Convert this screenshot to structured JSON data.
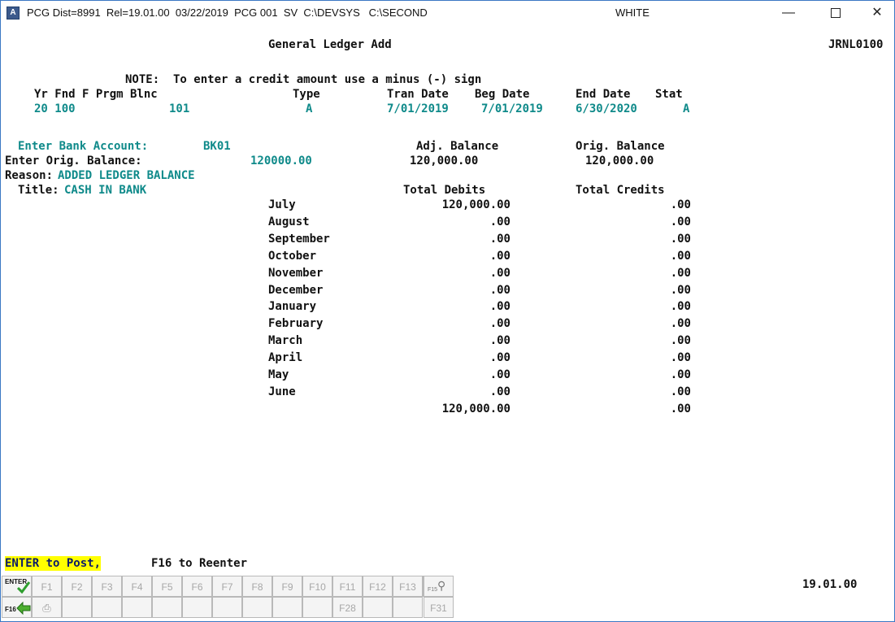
{
  "titlebar": {
    "info": "PCG Dist=8991  Rel=19.01.00  03/22/2019  PCG 001  SV  C:\\DEVSYS   C:\\SECOND",
    "user": "WHITE",
    "app_icon": "A"
  },
  "screen": {
    "title": "General Ledger Add",
    "code": "JRNL0100",
    "note": "NOTE:  To enter a credit amount use a minus (-) sign",
    "key_headers": {
      "yr_fnd_f_prgm_blnc": "Yr Fnd F Prgm Blnc",
      "type": "Type",
      "tran_date": "Tran Date",
      "beg_date": "Beg Date",
      "end_date": "End Date",
      "stat": "Stat"
    },
    "key_values": {
      "yr_fnd": "20 100",
      "blnc": "101",
      "type": "A",
      "tran_date": "7/01/2019",
      "beg_date": "7/01/2019",
      "end_date": "6/30/2020",
      "stat": "A"
    },
    "bank_account_label": "Enter Bank Account:",
    "bank_account_value": "BK01",
    "orig_balance_label": "Enter Orig. Balance:",
    "orig_balance_value": "120000.00",
    "reason_label": "Reason:",
    "reason_value": "ADDED LEDGER BALANCE",
    "title_label": "Title:",
    "title_value": "CASH IN BANK",
    "adj_balance_header": "Adj. Balance",
    "orig_balance_header": "Orig. Balance",
    "adj_balance_value": "120,000.00",
    "orig_balance_display": "120,000.00",
    "total_debits_header": "Total Debits",
    "total_credits_header": "Total Credits",
    "months": [
      {
        "name": "July",
        "debits": "120,000.00",
        "credits": ".00"
      },
      {
        "name": "August",
        "debits": ".00",
        "credits": ".00"
      },
      {
        "name": "September",
        "debits": ".00",
        "credits": ".00"
      },
      {
        "name": "October",
        "debits": ".00",
        "credits": ".00"
      },
      {
        "name": "November",
        "debits": ".00",
        "credits": ".00"
      },
      {
        "name": "December",
        "debits": ".00",
        "credits": ".00"
      },
      {
        "name": "January",
        "debits": ".00",
        "credits": ".00"
      },
      {
        "name": "February",
        "debits": ".00",
        "credits": ".00"
      },
      {
        "name": "March",
        "debits": ".00",
        "credits": ".00"
      },
      {
        "name": "April",
        "debits": ".00",
        "credits": ".00"
      },
      {
        "name": "May",
        "debits": ".00",
        "credits": ".00"
      },
      {
        "name": "June",
        "debits": ".00",
        "credits": ".00"
      }
    ],
    "totals": {
      "debits": "120,000.00",
      "credits": ".00"
    },
    "prompt_enter": "ENTER to Post,",
    "prompt_f16": "F16 to Reenter",
    "version": "19.01.00"
  },
  "fkeys": {
    "enter_label": "ENTER",
    "f16_label": "F16",
    "f15_label": "F15",
    "top": [
      "F1",
      "F2",
      "F3",
      "F4",
      "F5",
      "F6",
      "F7",
      "F8",
      "F9",
      "F10",
      "F11",
      "F12",
      "F13",
      "F14"
    ],
    "bottom_f28": "F28",
    "bottom_f31": "F31"
  }
}
